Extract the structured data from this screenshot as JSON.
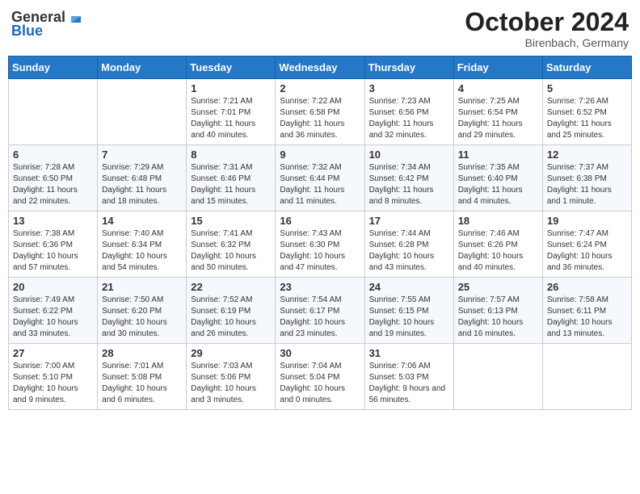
{
  "header": {
    "logo_general": "General",
    "logo_blue": "Blue",
    "month": "October 2024",
    "location": "Birenbach, Germany"
  },
  "weekdays": [
    "Sunday",
    "Monday",
    "Tuesday",
    "Wednesday",
    "Thursday",
    "Friday",
    "Saturday"
  ],
  "weeks": [
    [
      {
        "day": "",
        "sunrise": "",
        "sunset": "",
        "daylight": ""
      },
      {
        "day": "",
        "sunrise": "",
        "sunset": "",
        "daylight": ""
      },
      {
        "day": "1",
        "sunrise": "Sunrise: 7:21 AM",
        "sunset": "Sunset: 7:01 PM",
        "daylight": "Daylight: 11 hours and 40 minutes."
      },
      {
        "day": "2",
        "sunrise": "Sunrise: 7:22 AM",
        "sunset": "Sunset: 6:58 PM",
        "daylight": "Daylight: 11 hours and 36 minutes."
      },
      {
        "day": "3",
        "sunrise": "Sunrise: 7:23 AM",
        "sunset": "Sunset: 6:56 PM",
        "daylight": "Daylight: 11 hours and 32 minutes."
      },
      {
        "day": "4",
        "sunrise": "Sunrise: 7:25 AM",
        "sunset": "Sunset: 6:54 PM",
        "daylight": "Daylight: 11 hours and 29 minutes."
      },
      {
        "day": "5",
        "sunrise": "Sunrise: 7:26 AM",
        "sunset": "Sunset: 6:52 PM",
        "daylight": "Daylight: 11 hours and 25 minutes."
      }
    ],
    [
      {
        "day": "6",
        "sunrise": "Sunrise: 7:28 AM",
        "sunset": "Sunset: 6:50 PM",
        "daylight": "Daylight: 11 hours and 22 minutes."
      },
      {
        "day": "7",
        "sunrise": "Sunrise: 7:29 AM",
        "sunset": "Sunset: 6:48 PM",
        "daylight": "Daylight: 11 hours and 18 minutes."
      },
      {
        "day": "8",
        "sunrise": "Sunrise: 7:31 AM",
        "sunset": "Sunset: 6:46 PM",
        "daylight": "Daylight: 11 hours and 15 minutes."
      },
      {
        "day": "9",
        "sunrise": "Sunrise: 7:32 AM",
        "sunset": "Sunset: 6:44 PM",
        "daylight": "Daylight: 11 hours and 11 minutes."
      },
      {
        "day": "10",
        "sunrise": "Sunrise: 7:34 AM",
        "sunset": "Sunset: 6:42 PM",
        "daylight": "Daylight: 11 hours and 8 minutes."
      },
      {
        "day": "11",
        "sunrise": "Sunrise: 7:35 AM",
        "sunset": "Sunset: 6:40 PM",
        "daylight": "Daylight: 11 hours and 4 minutes."
      },
      {
        "day": "12",
        "sunrise": "Sunrise: 7:37 AM",
        "sunset": "Sunset: 6:38 PM",
        "daylight": "Daylight: 11 hours and 1 minute."
      }
    ],
    [
      {
        "day": "13",
        "sunrise": "Sunrise: 7:38 AM",
        "sunset": "Sunset: 6:36 PM",
        "daylight": "Daylight: 10 hours and 57 minutes."
      },
      {
        "day": "14",
        "sunrise": "Sunrise: 7:40 AM",
        "sunset": "Sunset: 6:34 PM",
        "daylight": "Daylight: 10 hours and 54 minutes."
      },
      {
        "day": "15",
        "sunrise": "Sunrise: 7:41 AM",
        "sunset": "Sunset: 6:32 PM",
        "daylight": "Daylight: 10 hours and 50 minutes."
      },
      {
        "day": "16",
        "sunrise": "Sunrise: 7:43 AM",
        "sunset": "Sunset: 6:30 PM",
        "daylight": "Daylight: 10 hours and 47 minutes."
      },
      {
        "day": "17",
        "sunrise": "Sunrise: 7:44 AM",
        "sunset": "Sunset: 6:28 PM",
        "daylight": "Daylight: 10 hours and 43 minutes."
      },
      {
        "day": "18",
        "sunrise": "Sunrise: 7:46 AM",
        "sunset": "Sunset: 6:26 PM",
        "daylight": "Daylight: 10 hours and 40 minutes."
      },
      {
        "day": "19",
        "sunrise": "Sunrise: 7:47 AM",
        "sunset": "Sunset: 6:24 PM",
        "daylight": "Daylight: 10 hours and 36 minutes."
      }
    ],
    [
      {
        "day": "20",
        "sunrise": "Sunrise: 7:49 AM",
        "sunset": "Sunset: 6:22 PM",
        "daylight": "Daylight: 10 hours and 33 minutes."
      },
      {
        "day": "21",
        "sunrise": "Sunrise: 7:50 AM",
        "sunset": "Sunset: 6:20 PM",
        "daylight": "Daylight: 10 hours and 30 minutes."
      },
      {
        "day": "22",
        "sunrise": "Sunrise: 7:52 AM",
        "sunset": "Sunset: 6:19 PM",
        "daylight": "Daylight: 10 hours and 26 minutes."
      },
      {
        "day": "23",
        "sunrise": "Sunrise: 7:54 AM",
        "sunset": "Sunset: 6:17 PM",
        "daylight": "Daylight: 10 hours and 23 minutes."
      },
      {
        "day": "24",
        "sunrise": "Sunrise: 7:55 AM",
        "sunset": "Sunset: 6:15 PM",
        "daylight": "Daylight: 10 hours and 19 minutes."
      },
      {
        "day": "25",
        "sunrise": "Sunrise: 7:57 AM",
        "sunset": "Sunset: 6:13 PM",
        "daylight": "Daylight: 10 hours and 16 minutes."
      },
      {
        "day": "26",
        "sunrise": "Sunrise: 7:58 AM",
        "sunset": "Sunset: 6:11 PM",
        "daylight": "Daylight: 10 hours and 13 minutes."
      }
    ],
    [
      {
        "day": "27",
        "sunrise": "Sunrise: 7:00 AM",
        "sunset": "Sunset: 5:10 PM",
        "daylight": "Daylight: 10 hours and 9 minutes."
      },
      {
        "day": "28",
        "sunrise": "Sunrise: 7:01 AM",
        "sunset": "Sunset: 5:08 PM",
        "daylight": "Daylight: 10 hours and 6 minutes."
      },
      {
        "day": "29",
        "sunrise": "Sunrise: 7:03 AM",
        "sunset": "Sunset: 5:06 PM",
        "daylight": "Daylight: 10 hours and 3 minutes."
      },
      {
        "day": "30",
        "sunrise": "Sunrise: 7:04 AM",
        "sunset": "Sunset: 5:04 PM",
        "daylight": "Daylight: 10 hours and 0 minutes."
      },
      {
        "day": "31",
        "sunrise": "Sunrise: 7:06 AM",
        "sunset": "Sunset: 5:03 PM",
        "daylight": "Daylight: 9 hours and 56 minutes."
      },
      {
        "day": "",
        "sunrise": "",
        "sunset": "",
        "daylight": ""
      },
      {
        "day": "",
        "sunrise": "",
        "sunset": "",
        "daylight": ""
      }
    ]
  ]
}
